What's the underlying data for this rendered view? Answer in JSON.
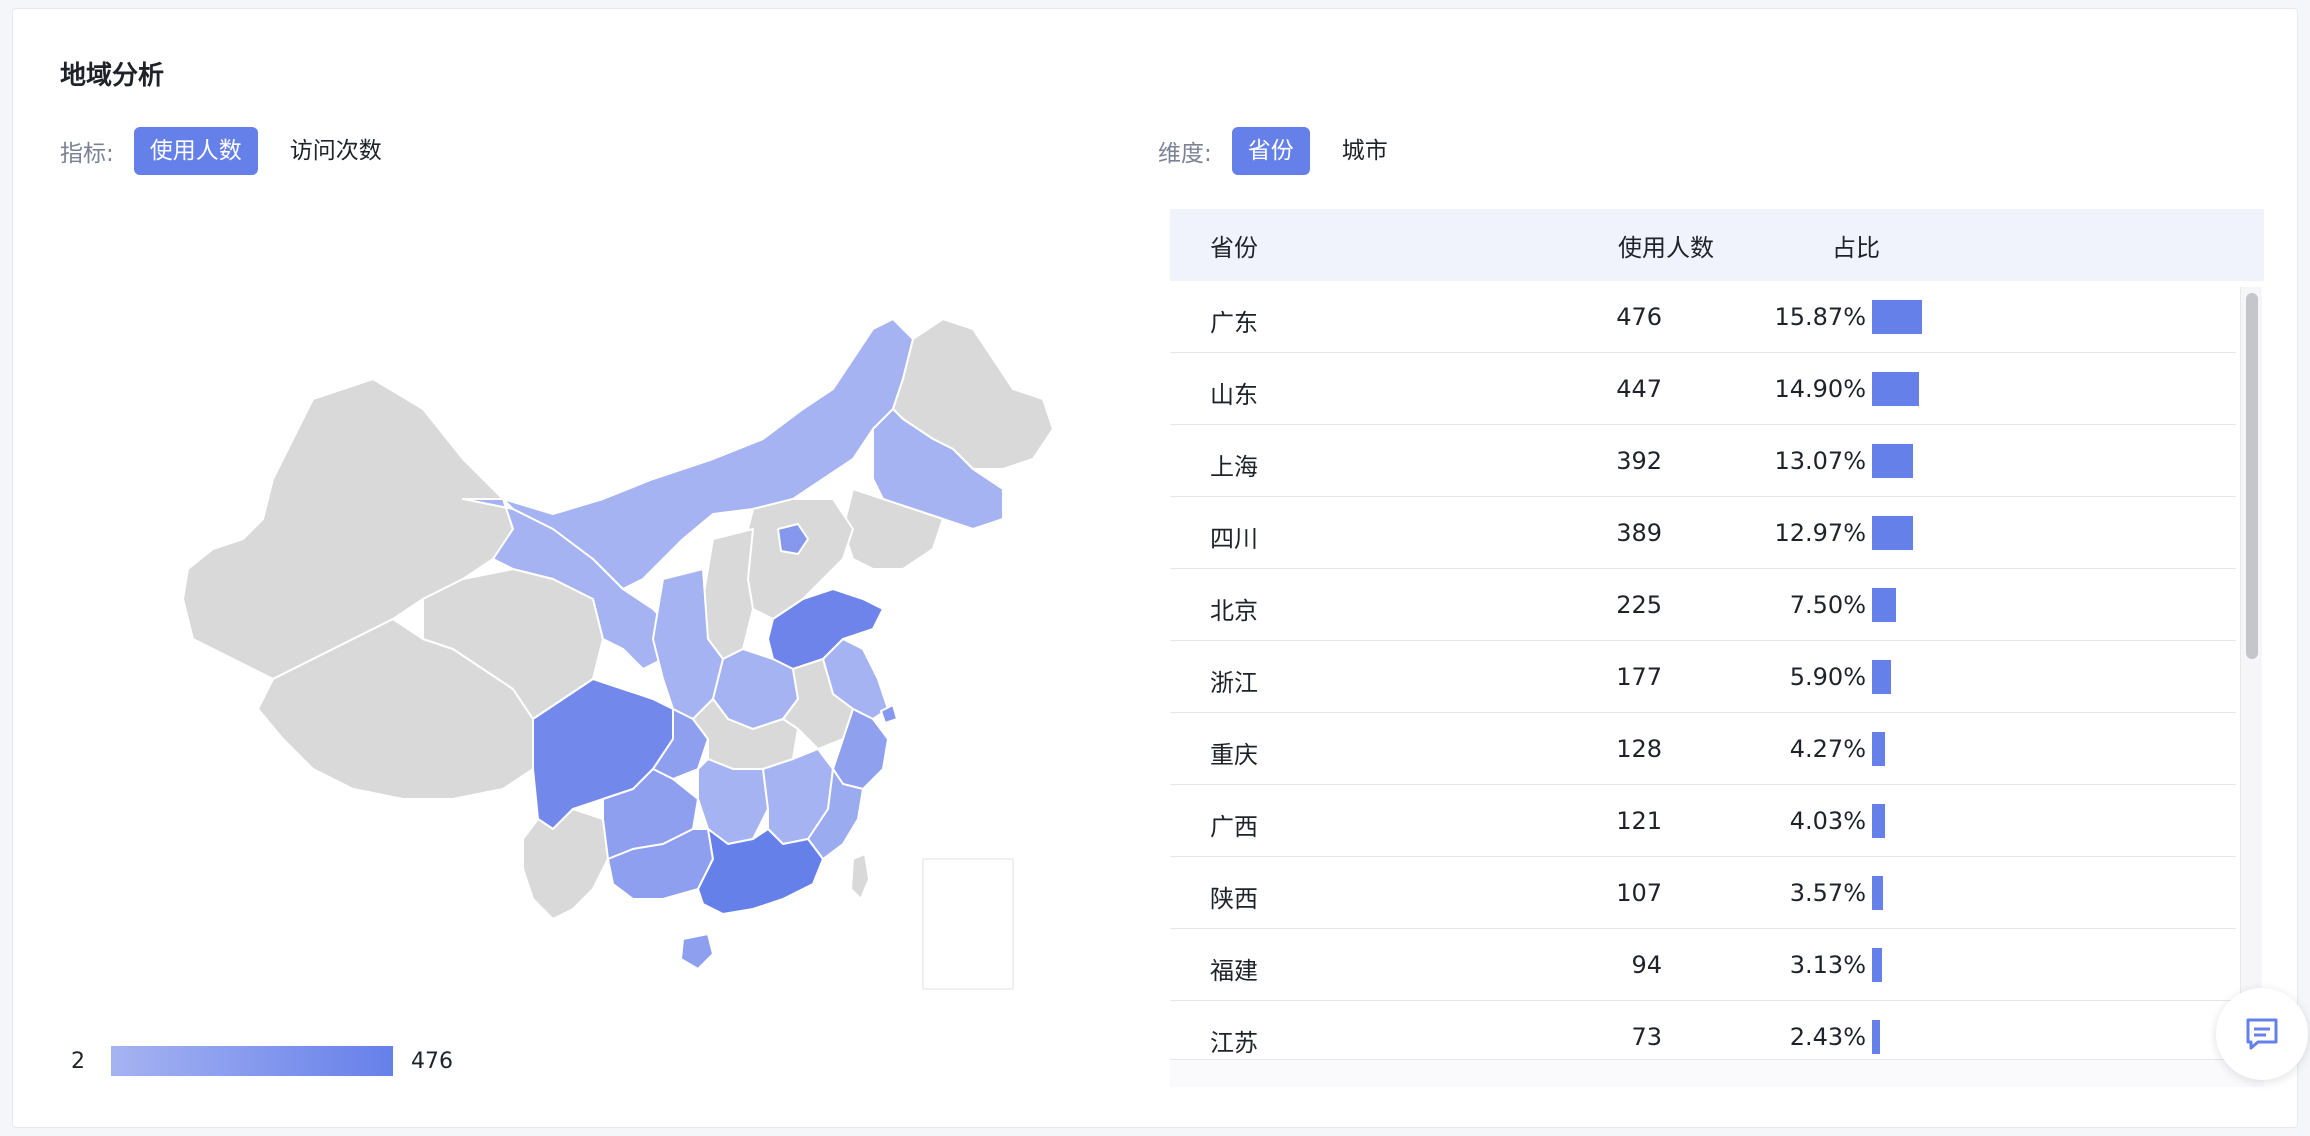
{
  "title": "地域分析",
  "metric": {
    "label": "指标:",
    "options": [
      "使用人数",
      "访问次数"
    ],
    "active": 0
  },
  "dimension": {
    "label": "维度:",
    "options": [
      "省份",
      "城市"
    ],
    "active": 0
  },
  "legend": {
    "min": "2",
    "max": "476"
  },
  "colors": {
    "accent": "#6680ea",
    "light": "#a6b3f2",
    "nodata": "#d9d9d9"
  },
  "table": {
    "headers": {
      "province": "省份",
      "users": "使用人数",
      "share": "占比"
    },
    "rows": [
      {
        "province": "广东",
        "users": "476",
        "pct": "15.87%",
        "share": 15.87
      },
      {
        "province": "山东",
        "users": "447",
        "pct": "14.90%",
        "share": 14.9
      },
      {
        "province": "上海",
        "users": "392",
        "pct": "13.07%",
        "share": 13.07
      },
      {
        "province": "四川",
        "users": "389",
        "pct": "12.97%",
        "share": 12.97
      },
      {
        "province": "北京",
        "users": "225",
        "pct": "7.50%",
        "share": 7.5
      },
      {
        "province": "浙江",
        "users": "177",
        "pct": "5.90%",
        "share": 5.9
      },
      {
        "province": "重庆",
        "users": "128",
        "pct": "4.27%",
        "share": 4.27
      },
      {
        "province": "广西",
        "users": "121",
        "pct": "4.03%",
        "share": 4.03
      },
      {
        "province": "陕西",
        "users": "107",
        "pct": "3.57%",
        "share": 3.57
      },
      {
        "province": "福建",
        "users": "94",
        "pct": "3.13%",
        "share": 3.13
      },
      {
        "province": "江苏",
        "users": "73",
        "pct": "2.43%",
        "share": 2.43
      }
    ]
  },
  "icons": {
    "chat": "chat-message-icon"
  }
}
